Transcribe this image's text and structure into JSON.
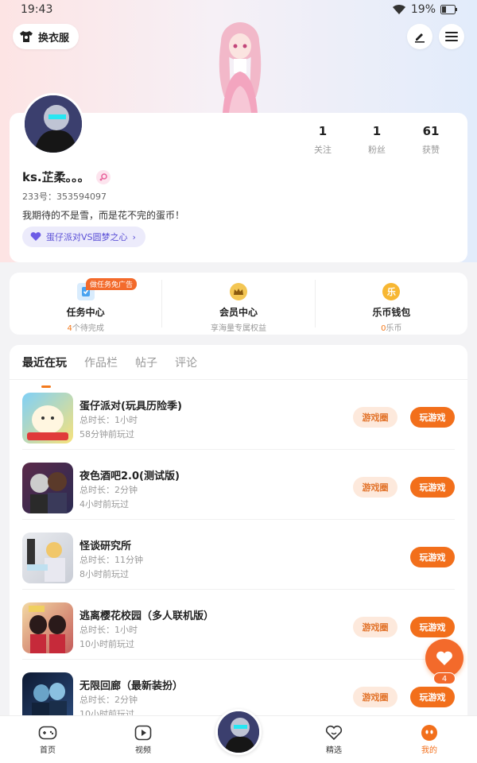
{
  "status_bar": {
    "time": "19:43",
    "battery": "19%"
  },
  "header": {
    "outfit_label": "换衣服"
  },
  "profile": {
    "stats": [
      {
        "value": "1",
        "label": "关注"
      },
      {
        "value": "1",
        "label": "粉丝"
      },
      {
        "value": "61",
        "label": "获赞"
      }
    ],
    "username": "ks.芷柔。。。",
    "id_text": "233号：353594097",
    "bio": "我期待的不是雪，而是花不完的蛋币！",
    "tag_label": "蛋仔派对VS圆梦之心"
  },
  "quick": {
    "task": {
      "title": "任务中心",
      "count": "4",
      "sub": "个待完成",
      "ad": "做任务免广告"
    },
    "member": {
      "title": "会员中心",
      "sub": "享海量专属权益"
    },
    "wallet": {
      "title": "乐币钱包",
      "count": "0",
      "sub": "乐币"
    }
  },
  "tabs": [
    "最近在玩",
    "作品栏",
    "帖子",
    "评论"
  ],
  "games": [
    {
      "name": "蛋仔派对(玩具历险季)",
      "duration": "总时长：1小时",
      "last": "58分钟前玩过",
      "circle": "游戏圈",
      "play": "玩游戏"
    },
    {
      "name": "夜色酒吧2.0(测试版)",
      "duration": "总时长：2分钟",
      "last": "4小时前玩过",
      "circle": "游戏圈",
      "play": "玩游戏"
    },
    {
      "name": "怪谈研究所",
      "duration": "总时长：11分钟",
      "last": "8小时前玩过",
      "circle": "",
      "play": "玩游戏"
    },
    {
      "name": "逃离樱花校园（多人联机版）",
      "duration": "总时长：1小时",
      "last": "10小时前玩过",
      "circle": "游戏圈",
      "play": "玩游戏"
    },
    {
      "name": "无限回廊（最新装扮）",
      "duration": "总时长：2分钟",
      "last": "10小时前玩过",
      "circle": "游戏圈",
      "play": "玩游戏"
    }
  ],
  "fab_count": "4",
  "nav": [
    {
      "label": "首页",
      "icon": "gamepad-icon"
    },
    {
      "label": "视频",
      "icon": "video-play-icon"
    },
    {
      "label": "精选",
      "icon": "heart-outline-icon"
    },
    {
      "label": "我的",
      "icon": "smiley-icon"
    }
  ],
  "colors": {
    "accent": "#f26f1b",
    "tag_purple": "#5a4fd6"
  }
}
